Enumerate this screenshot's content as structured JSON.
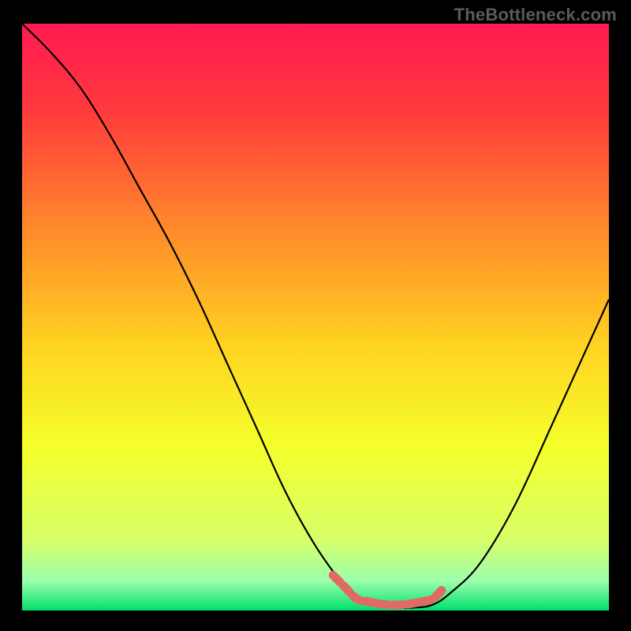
{
  "watermark": "TheBottleneck.com",
  "chart_data": {
    "type": "line",
    "title": "",
    "xlabel": "",
    "ylabel": "",
    "xlim": [
      0,
      100
    ],
    "ylim": [
      0,
      100
    ],
    "background_gradient": {
      "stops": [
        {
          "offset": 0.0,
          "color": "#ff1a52"
        },
        {
          "offset": 0.15,
          "color": "#ff3a3c"
        },
        {
          "offset": 0.35,
          "color": "#ff8a2a"
        },
        {
          "offset": 0.55,
          "color": "#ffd321"
        },
        {
          "offset": 0.72,
          "color": "#f4ff2a"
        },
        {
          "offset": 0.88,
          "color": "#d7ff6a"
        },
        {
          "offset": 0.95,
          "color": "#9cffad"
        },
        {
          "offset": 1.0,
          "color": "#00e06c"
        }
      ]
    },
    "series": [
      {
        "name": "bottleneck-curve",
        "color": "#000000",
        "x": [
          0,
          5,
          10,
          15,
          20,
          25,
          30,
          35,
          40,
          45,
          50,
          55,
          57,
          60,
          63,
          67,
          70,
          73,
          78,
          84,
          90,
          95,
          100
        ],
        "values": [
          100,
          95,
          89,
          81,
          72,
          63,
          53,
          42,
          31,
          20,
          11,
          4,
          2,
          1,
          0.5,
          0.5,
          1,
          3,
          8,
          18,
          31,
          42,
          53
        ]
      },
      {
        "name": "optimal-zone-marker",
        "color": "#e16a63",
        "x": [
          53,
          55,
          57,
          59,
          62,
          65,
          68,
          70,
          72
        ],
        "values": [
          6,
          4,
          2,
          1.5,
          1,
          1,
          1.5,
          2,
          4
        ]
      }
    ],
    "annotations": []
  }
}
